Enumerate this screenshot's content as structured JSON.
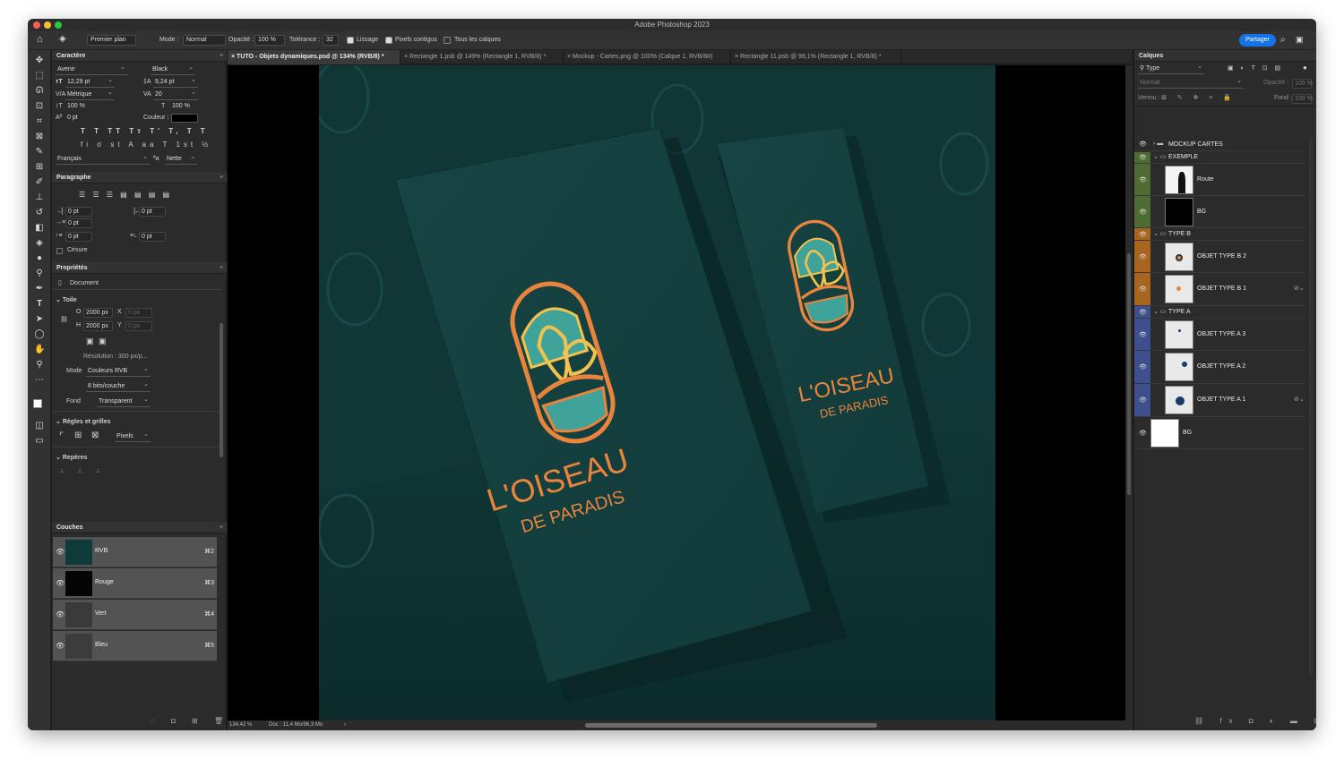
{
  "window": {
    "title": "Adobe Photoshop 2023"
  },
  "options_bar": {
    "tool_preset": "Premier plan",
    "mode_label": "Mode :",
    "mode_value": "Normal",
    "opacity_label": "Opacité :",
    "opacity_value": "100 %",
    "tolerance_label": "Tolérance :",
    "tolerance_value": "32",
    "smoothing_label": "Lissage",
    "contiguous_label": "Pixels contigus",
    "all_layers_label": "Tous les calques",
    "share_label": "Partager"
  },
  "character_panel": {
    "title": "Caractère",
    "font_family": "Avenir",
    "font_style": "Black",
    "font_size": "12,29 pt",
    "leading": "9,24 pt",
    "kerning": "Métrique",
    "tracking": "20",
    "vscale": "100 %",
    "hscale": "100 %",
    "baseline": "0 pt",
    "color_label": "Couleur :",
    "language": "Français",
    "aa_icon": "ªa",
    "antialias": "Nette"
  },
  "paragraph_panel": {
    "title": "Paragraphe",
    "indent_left": "0 pt",
    "indent_right": "0 pt",
    "indent_first": "0 pt",
    "space_before": "0 pt",
    "space_after": "0 pt",
    "hyphenation": "Césure"
  },
  "properties_panel": {
    "title": "Propriétés",
    "doc_label": "Document",
    "section_canvas": "Toile",
    "w_label": "O",
    "w_value": "2000 px",
    "h_label": "H",
    "h_value": "2000 px",
    "x_label": "X",
    "x_value": "0 px",
    "y_label": "Y",
    "y_value": "0 px",
    "resolution": "Résolution : 300 px/p...",
    "mode_label": "Mode",
    "mode_value": "Couleurs RVB",
    "depth_value": "8 bits/couche",
    "fill_label": "Fond",
    "fill_value": "Transparent",
    "section_rulers": "Règles et grilles",
    "units_value": "Pixels",
    "section_guides": "Repères"
  },
  "channels_panel": {
    "title": "Couches",
    "channels": [
      {
        "name": "RVB",
        "shortcut": "⌘2"
      },
      {
        "name": "Rouge",
        "shortcut": "⌘3"
      },
      {
        "name": "Vert",
        "shortcut": "⌘4"
      },
      {
        "name": "Bleu",
        "shortcut": "⌘5"
      }
    ]
  },
  "tabs": [
    "TUTO - Objets dynamiques.psd @ 134% (RVB/8) *",
    "Rectangle 1.psb @ 149% (Rectangle 1, RVB/8) *",
    "Mockup - Cartes.png @ 100% (Calque 1, RVB/8#)",
    "Rectangle 11.psb @ 99,1% (Rectangle 1, RVB/8) *"
  ],
  "canvas": {
    "brand_line1": "L'OISEAU",
    "brand_line2": "DE PARADIS",
    "colors": {
      "background": "#0f3232",
      "card": "#174242",
      "orange": "#e8843c",
      "yellow": "#f2c14e",
      "teal": "#3fa39a"
    }
  },
  "status": {
    "zoom": "134,42 %",
    "doc": "Doc : 11,4 Mo/96,3 Mo",
    "arrow": "›"
  },
  "layers_panel": {
    "title": "Calques",
    "filter_value": "Type",
    "blend_value": "Normal",
    "opacity_label": "Opacité :",
    "opacity_value": "100 %",
    "lock_label": "Verrou :",
    "fill_label": "Fond :",
    "fill_value": "100 %",
    "layers": [
      {
        "name": "MOCKUP CARTES"
      },
      {
        "name": "EXEMPLE"
      },
      {
        "name": "Route"
      },
      {
        "name": "BG"
      },
      {
        "name": "TYPE B"
      },
      {
        "name": "OBJET TYPE B 2"
      },
      {
        "name": "OBJET TYPE B 1"
      },
      {
        "name": "TYPE A"
      },
      {
        "name": "OBJET TYPE A 3"
      },
      {
        "name": "OBJET TYPE A 2"
      },
      {
        "name": "OBJET TYPE A 1"
      },
      {
        "name": "BG"
      }
    ],
    "group_colors": {
      "exemple": "#4e6b34",
      "type_b": "#a8651f",
      "type_a": "#3d4f8c"
    }
  }
}
